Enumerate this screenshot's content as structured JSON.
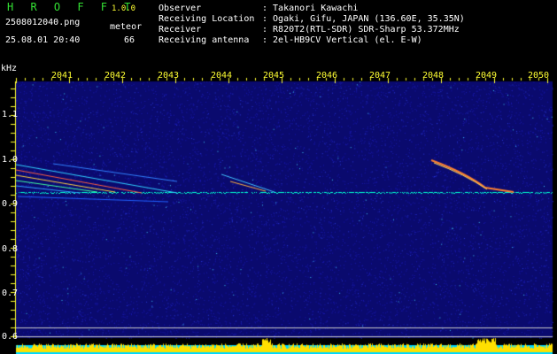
{
  "header": {
    "brand": "H R O F F T",
    "version": "1.0.0",
    "filename": "2508012040.png",
    "meteor_label": "meteor",
    "datetime": "25.08.01 20:40",
    "meteor_count": "66"
  },
  "info": [
    {
      "key": "Observer",
      "value": ": Takanori Kawachi"
    },
    {
      "key": "Receiving Location",
      "value": ": Ogaki, Gifu, JAPAN (136.60E, 35.35N)"
    },
    {
      "key": "Receiver",
      "value": ": R820T2(RTL-SDR) SDR-Sharp 53.372MHz"
    },
    {
      "key": "Receiving antenna",
      "value": ": 2el-HB9CV Vertical (el. E-W)"
    }
  ],
  "axis": {
    "y_unit": "kHz",
    "y_ticks": [
      "1.1",
      "1.0",
      "0.9",
      "0.8",
      "0.7",
      "0.6"
    ],
    "x_ticks": [
      "2041",
      "2042",
      "2043",
      "2044",
      "2045",
      "2046",
      "2047",
      "2048",
      "2049",
      "2050"
    ]
  },
  "colors": {
    "background": "#000000",
    "spectrum_bg": "#0a0a6e",
    "carrier": "#00ffd0",
    "meteor_trail": "#ff8030",
    "tick_marks": "#ffff33",
    "level_bar": "#ffe000",
    "level_base": "#00d8ff"
  }
}
